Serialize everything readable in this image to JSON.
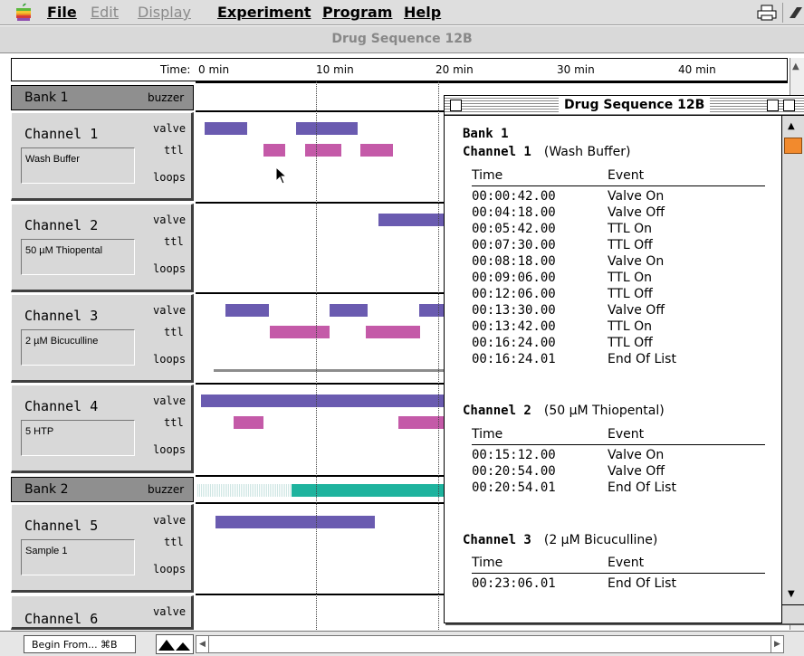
{
  "menubar": {
    "items": [
      {
        "label": "File",
        "enabled": true
      },
      {
        "label": "Edit",
        "enabled": false
      },
      {
        "label": "Display",
        "enabled": false
      },
      {
        "label": "Experiment",
        "enabled": true
      },
      {
        "label": "Program",
        "enabled": true
      },
      {
        "label": "Help",
        "enabled": true
      }
    ]
  },
  "window": {
    "title": "Drug Sequence 12B"
  },
  "ruler": {
    "labels": [
      "Time:",
      "0 min",
      "10 min",
      "20 min",
      "30 min",
      "40 min"
    ]
  },
  "left_panel": {
    "banks": [
      {
        "label": "Bank 1",
        "buzzer_label": "buzzer"
      },
      {
        "label": "Bank 2",
        "buzzer_label": "buzzer"
      }
    ],
    "row_labels": {
      "valve": "valve",
      "ttl": "ttl",
      "loops": "loops"
    },
    "channels": [
      {
        "name": "Channel 1",
        "description": "Wash Buffer"
      },
      {
        "name": "Channel 2",
        "description": "50 µM Thiopental"
      },
      {
        "name": "Channel 3",
        "description": "2 µM Bicuculline"
      },
      {
        "name": "Channel 4",
        "description": "5 HTP"
      },
      {
        "name": "Channel 5",
        "description": "Sample 1"
      },
      {
        "name": "Channel 6",
        "description": ""
      }
    ]
  },
  "colors": {
    "valve": "#6a5bb0",
    "ttl": "#c45aa8",
    "buzzer": "#1eb39e",
    "loop": "#8c8c8c"
  },
  "bottombar": {
    "begin_label": "Begin From...  ⌘B"
  },
  "event_window": {
    "title": "Drug Sequence 12B",
    "bank": "Bank 1",
    "col_time": "Time",
    "col_event": "Event",
    "channels": [
      {
        "name": "Channel 1",
        "description": "(Wash Buffer)",
        "events": [
          {
            "time": "00:00:42.00",
            "event": "Valve On"
          },
          {
            "time": "00:04:18.00",
            "event": "Valve Off"
          },
          {
            "time": "00:05:42.00",
            "event": "TTL On"
          },
          {
            "time": "00:07:30.00",
            "event": "TTL Off"
          },
          {
            "time": "00:08:18.00",
            "event": "Valve On"
          },
          {
            "time": "00:09:06.00",
            "event": "TTL On"
          },
          {
            "time": "00:12:06.00",
            "event": "TTL Off"
          },
          {
            "time": "00:13:30.00",
            "event": "Valve Off"
          },
          {
            "time": "00:13:42.00",
            "event": "TTL On"
          },
          {
            "time": "00:16:24.00",
            "event": "TTL Off"
          },
          {
            "time": "00:16:24.01",
            "event": "End Of List"
          }
        ]
      },
      {
        "name": "Channel 2",
        "description": "(50 µM Thiopental)",
        "events": [
          {
            "time": "00:15:12.00",
            "event": "Valve On"
          },
          {
            "time": "00:20:54.00",
            "event": "Valve Off"
          },
          {
            "time": "00:20:54.01",
            "event": "End Of List"
          }
        ]
      },
      {
        "name": "Channel 3",
        "description": "(2 µM Bicuculline)",
        "events": [
          {
            "time": "00:23:06.01",
            "event": "End Of List"
          }
        ]
      }
    ]
  }
}
